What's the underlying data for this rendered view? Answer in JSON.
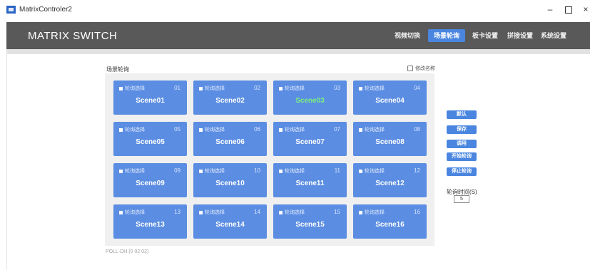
{
  "window": {
    "title": "MatrixControler2",
    "minimize": "–",
    "close": "×"
  },
  "header": {
    "brand": "MATRIX SWITCH",
    "tabs": [
      {
        "label": "视频切换",
        "active": false
      },
      {
        "label": "场景轮询",
        "active": true
      },
      {
        "label": "板卡设置",
        "active": false
      },
      {
        "label": "拼接设置",
        "active": false
      },
      {
        "label": "系统设置",
        "active": false
      }
    ]
  },
  "main": {
    "section_title": "场景轮询",
    "rename_label": "修改名称",
    "cards": [
      {
        "select_label": "轮询选择",
        "number": "01",
        "name": "Scene01",
        "active": false
      },
      {
        "select_label": "轮询选择",
        "number": "02",
        "name": "Scene02",
        "active": false
      },
      {
        "select_label": "轮询选择",
        "number": "03",
        "name": "Scene03",
        "active": true
      },
      {
        "select_label": "轮询选择",
        "number": "04",
        "name": "Scene04",
        "active": false
      },
      {
        "select_label": "轮询选择",
        "number": "05",
        "name": "Scene05",
        "active": false
      },
      {
        "select_label": "轮询选择",
        "number": "06",
        "name": "Scene06",
        "active": false
      },
      {
        "select_label": "轮询选择",
        "number": "07",
        "name": "Scene07",
        "active": false
      },
      {
        "select_label": "轮询选择",
        "number": "08",
        "name": "Scene08",
        "active": false
      },
      {
        "select_label": "轮询选择",
        "number": "09",
        "name": "Scene09",
        "active": false
      },
      {
        "select_label": "轮询选择",
        "number": "10",
        "name": "Scene10",
        "active": false
      },
      {
        "select_label": "轮询选择",
        "number": "11",
        "name": "Scene11",
        "active": false
      },
      {
        "select_label": "轮询选择",
        "number": "12",
        "name": "Scene12",
        "active": false
      },
      {
        "select_label": "轮询选择",
        "number": "13",
        "name": "Scene13",
        "active": false
      },
      {
        "select_label": "轮询选择",
        "number": "14",
        "name": "Scene14",
        "active": false
      },
      {
        "select_label": "轮询选择",
        "number": "15",
        "name": "Scene15",
        "active": false
      },
      {
        "select_label": "轮询选择",
        "number": "16",
        "name": "Scene16",
        "active": false
      }
    ],
    "footer_text": "POLL-DH (0 02 02)"
  },
  "side": {
    "buttons": [
      "默认",
      "保存",
      "调用",
      "开始轮询",
      "停止轮询"
    ],
    "poll_time_label": "轮询时间(S)",
    "poll_time_value": "5"
  },
  "colors": {
    "header_bg": "#595959",
    "accent": "#4a86e0",
    "card_bg": "#5b8de2",
    "active_scene_text": "#7cf07c",
    "panel_bg": "#f0f0f0"
  }
}
